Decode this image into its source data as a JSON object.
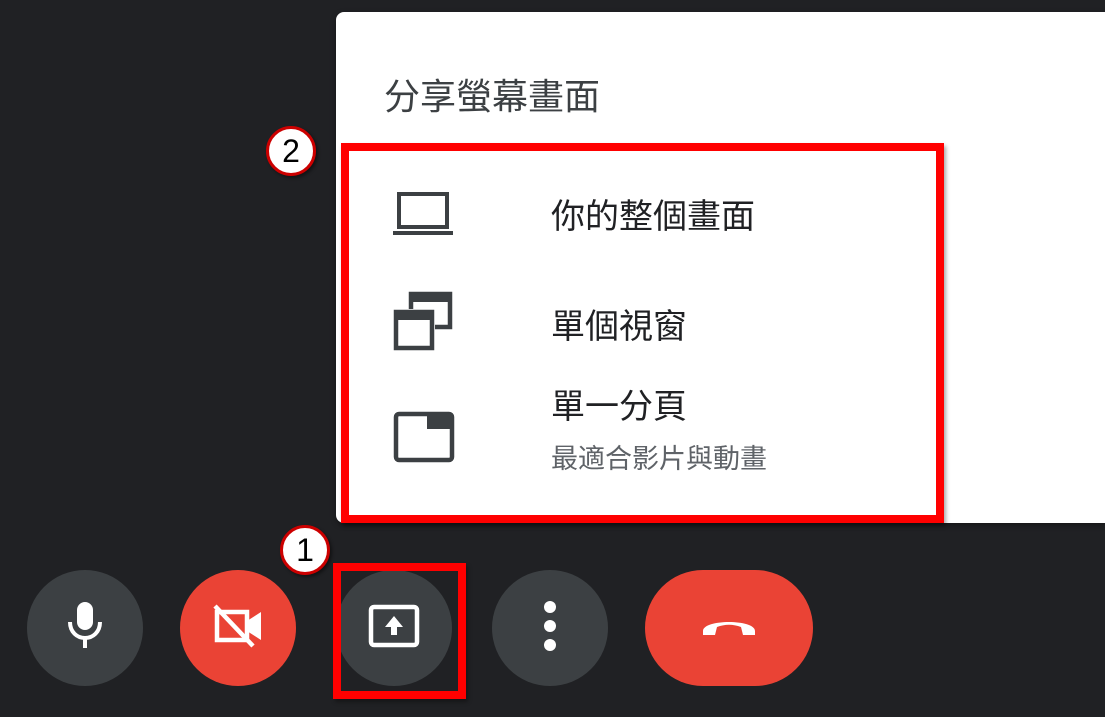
{
  "menu": {
    "title": "分享螢幕畫面",
    "options": [
      {
        "label": "你的整個畫面",
        "icon": "laptop-icon"
      },
      {
        "label": "單個視窗",
        "icon": "window-icon"
      },
      {
        "label": "單一分頁",
        "sublabel": "最適合影片與動畫",
        "icon": "tab-icon"
      }
    ]
  },
  "annotations": {
    "step1": "1",
    "step2": "2"
  },
  "controls": [
    {
      "name": "microphone",
      "icon": "microphone-icon"
    },
    {
      "name": "camera-off",
      "icon": "camera-off-icon"
    },
    {
      "name": "present-now",
      "icon": "present-screen-icon"
    },
    {
      "name": "more-options",
      "icon": "more-vert-icon"
    },
    {
      "name": "leave-call",
      "icon": "hang-up-icon"
    }
  ],
  "colors": {
    "background": "#202124",
    "control_gray": "#3c4043",
    "danger_red": "#ea4335",
    "highlight": "#ff0000",
    "menu_bg": "#ffffff"
  }
}
